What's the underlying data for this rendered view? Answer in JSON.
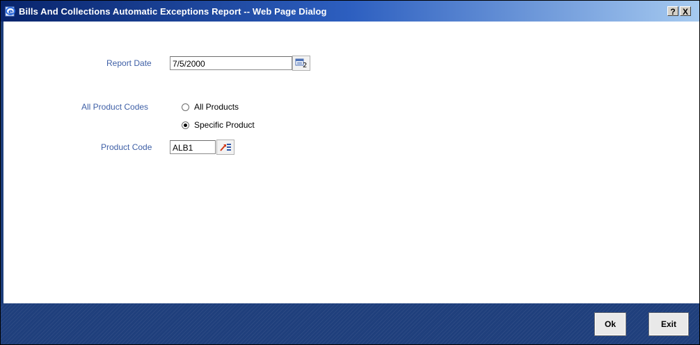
{
  "window": {
    "title": "Bills And Collections Automatic Exceptions Report -- Web Page Dialog",
    "help_label": "?",
    "close_label": "X"
  },
  "form": {
    "report_date_label": "Report Date",
    "report_date_value": "7/5/2000",
    "product_codes_label": "All Product Codes",
    "options": [
      {
        "label": "All Products",
        "selected": false
      },
      {
        "label": "Specific Product",
        "selected": true
      }
    ],
    "product_code_label": "Product Code",
    "product_code_value": "ALB1"
  },
  "footer": {
    "ok_label": "Ok",
    "exit_label": "Exit"
  },
  "colors": {
    "label": "#3e5fa6",
    "footer": "#1f3f7c",
    "titlebar_start": "#08246b",
    "titlebar_end": "#a6caf0"
  }
}
